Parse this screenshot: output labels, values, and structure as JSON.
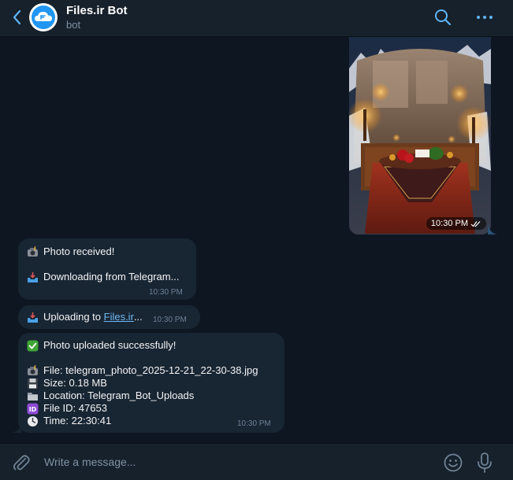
{
  "header": {
    "title": "Files.ir Bot",
    "subtitle": "bot"
  },
  "photo_message": {
    "time": "10:30 PM",
    "status_icon": "double-check-icon"
  },
  "messages": [
    {
      "lines": [
        {
          "icon": "camera-flash-icon",
          "text": "Photo received!"
        },
        {
          "icon": "inbox-tray-icon",
          "text": "Downloading from Telegram..."
        }
      ],
      "time": "10:30 PM"
    },
    {
      "prefix_icon": "inbox-tray-icon",
      "prefix": "Uploading to ",
      "link": "Files.ir",
      "suffix": "...",
      "time": "10:30 PM"
    },
    {
      "lines": [
        {
          "icon": "check-mark-button-icon",
          "text": "Photo uploaded successfully!"
        },
        {
          "icon": "camera-flash-icon",
          "text": "File: telegram_photo_2025-12-21_22-30-38.jpg"
        },
        {
          "icon": "floppy-disk-icon",
          "text": "Size: 0.18 MB"
        },
        {
          "icon": "folder-icon",
          "text": "Location: Telegram_Bot_Uploads"
        },
        {
          "icon": "id-button-icon",
          "text": "File ID: 47653"
        },
        {
          "icon": "clock-icon",
          "text": "Time: 22:30:41"
        }
      ],
      "time": "10:30 PM"
    }
  ],
  "composer": {
    "placeholder": "Write a message..."
  },
  "colors": {
    "background": "#0e1621",
    "header": "#17212b",
    "incoming_bubble": "#182533",
    "accent": "#5eb5f7",
    "link": "#71baf2",
    "time": "#6d8297"
  }
}
